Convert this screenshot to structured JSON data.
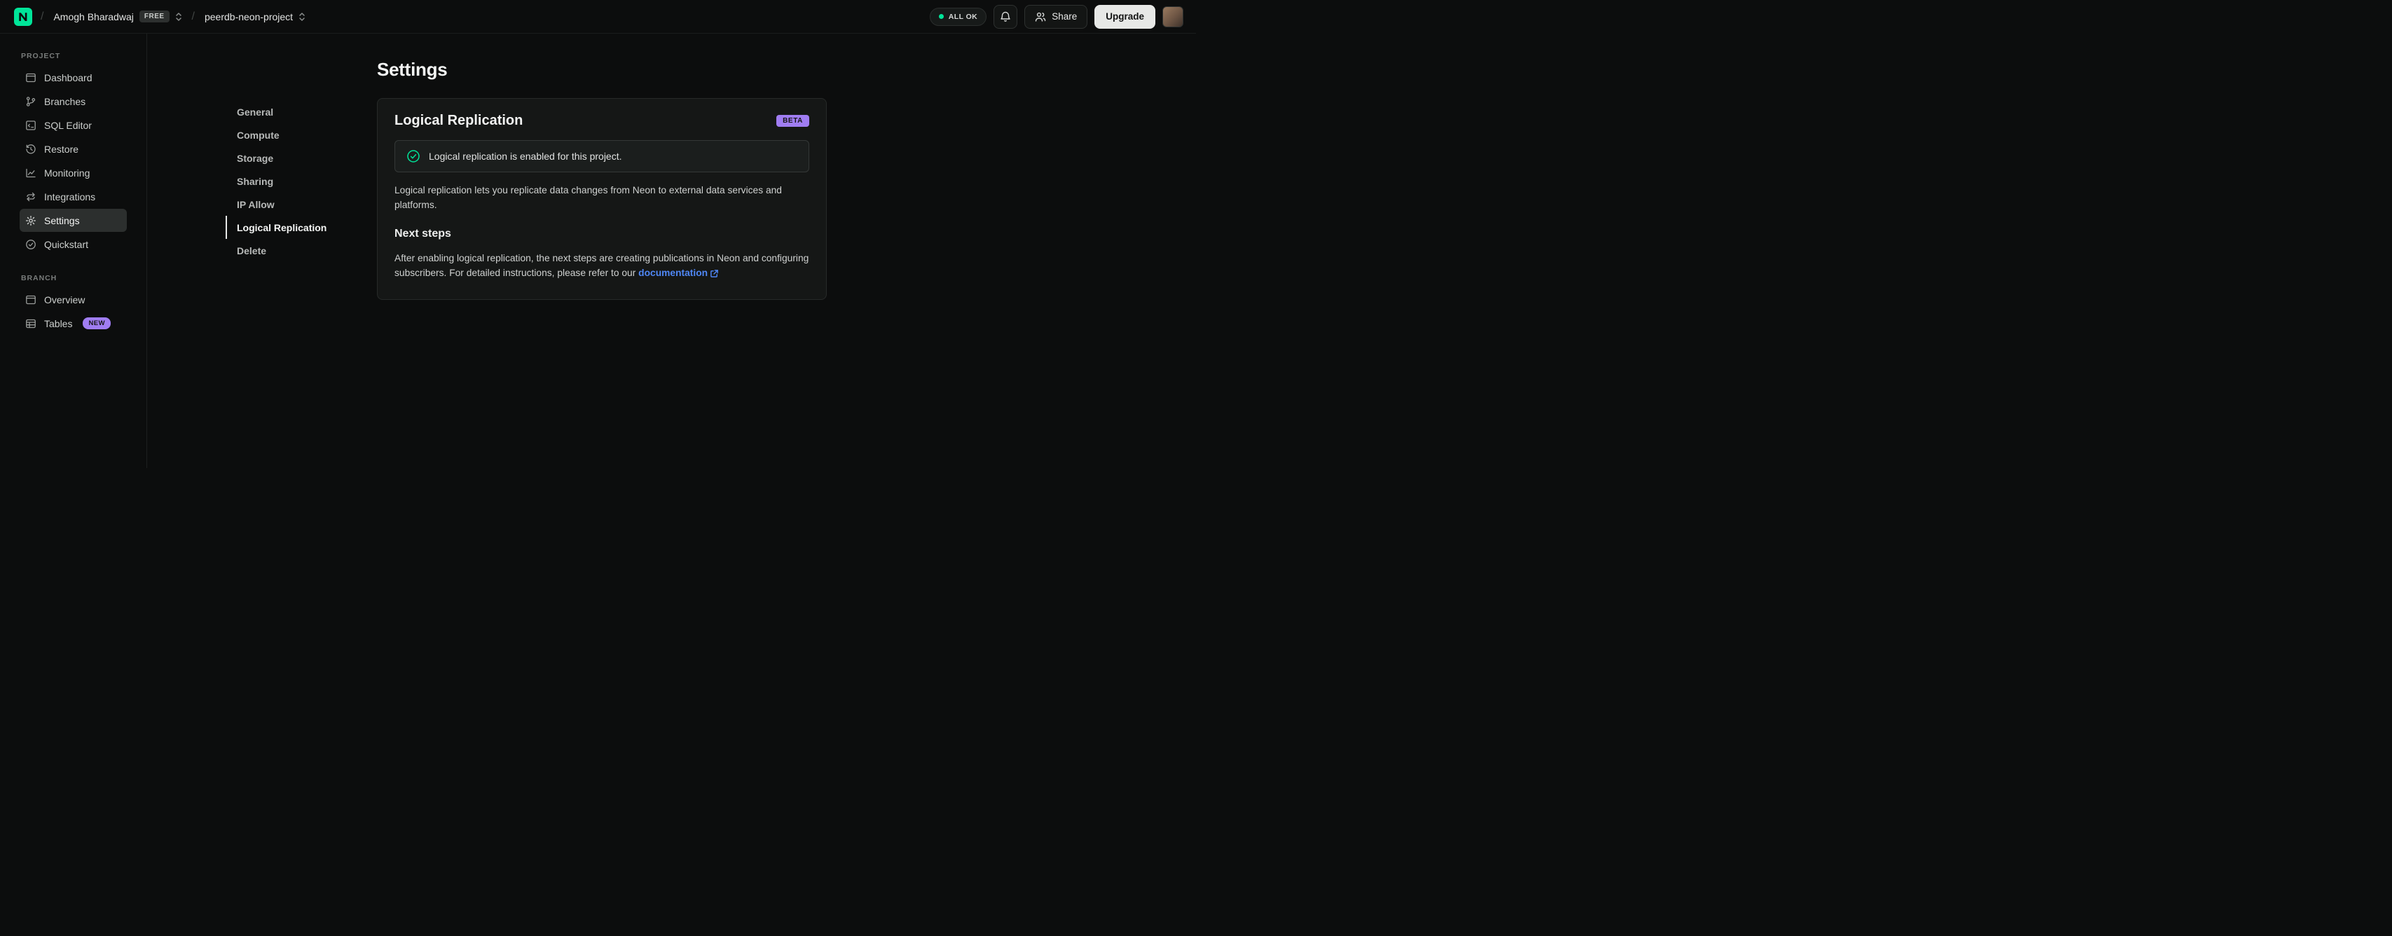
{
  "colors": {
    "accent_green": "#00e599",
    "badge_purple": "#a07df2",
    "link_blue": "#4f87f5",
    "background": "#0c0d0d"
  },
  "topbar": {
    "separator": "/",
    "org_name": "Amogh Bharadwaj",
    "org_plan_badge": "FREE",
    "project_name": "peerdb-neon-project",
    "status_label": "ALL OK",
    "share_label": "Share",
    "upgrade_label": "Upgrade",
    "icons": {
      "logo": "neon-logo",
      "bell": "bell-icon",
      "share": "users-icon",
      "selector": "chevron-updown-icon"
    }
  },
  "sidebar": {
    "sections": [
      {
        "label": "PROJECT",
        "items": [
          {
            "label": "Dashboard",
            "icon": "dashboard-icon"
          },
          {
            "label": "Branches",
            "icon": "git-branch-icon"
          },
          {
            "label": "SQL Editor",
            "icon": "sql-editor-icon"
          },
          {
            "label": "Restore",
            "icon": "restore-icon"
          },
          {
            "label": "Monitoring",
            "icon": "monitoring-icon"
          },
          {
            "label": "Integrations",
            "icon": "integrations-icon"
          },
          {
            "label": "Settings",
            "icon": "gear-icon",
            "active": true
          },
          {
            "label": "Quickstart",
            "icon": "check-circle-icon"
          }
        ]
      },
      {
        "label": "BRANCH",
        "items": [
          {
            "label": "Overview",
            "icon": "overview-icon"
          },
          {
            "label": "Tables",
            "icon": "table-icon",
            "badge": "NEW"
          }
        ]
      }
    ]
  },
  "main": {
    "page_title": "Settings",
    "nav": [
      {
        "label": "General"
      },
      {
        "label": "Compute"
      },
      {
        "label": "Storage"
      },
      {
        "label": "Sharing"
      },
      {
        "label": "IP Allow"
      },
      {
        "label": "Logical Replication",
        "active": true
      },
      {
        "label": "Delete"
      }
    ],
    "card": {
      "title": "Logical Replication",
      "badge": "BETA",
      "banner_text": "Logical replication is enabled for this project.",
      "description": "Logical replication lets you replicate data changes from Neon to external data services and platforms.",
      "next_steps_title": "Next steps",
      "next_steps_text": "After enabling logical replication, the next steps are creating publications in Neon and configuring subscribers. For detailed instructions, please refer to our",
      "doc_link_label": "documentation"
    }
  }
}
